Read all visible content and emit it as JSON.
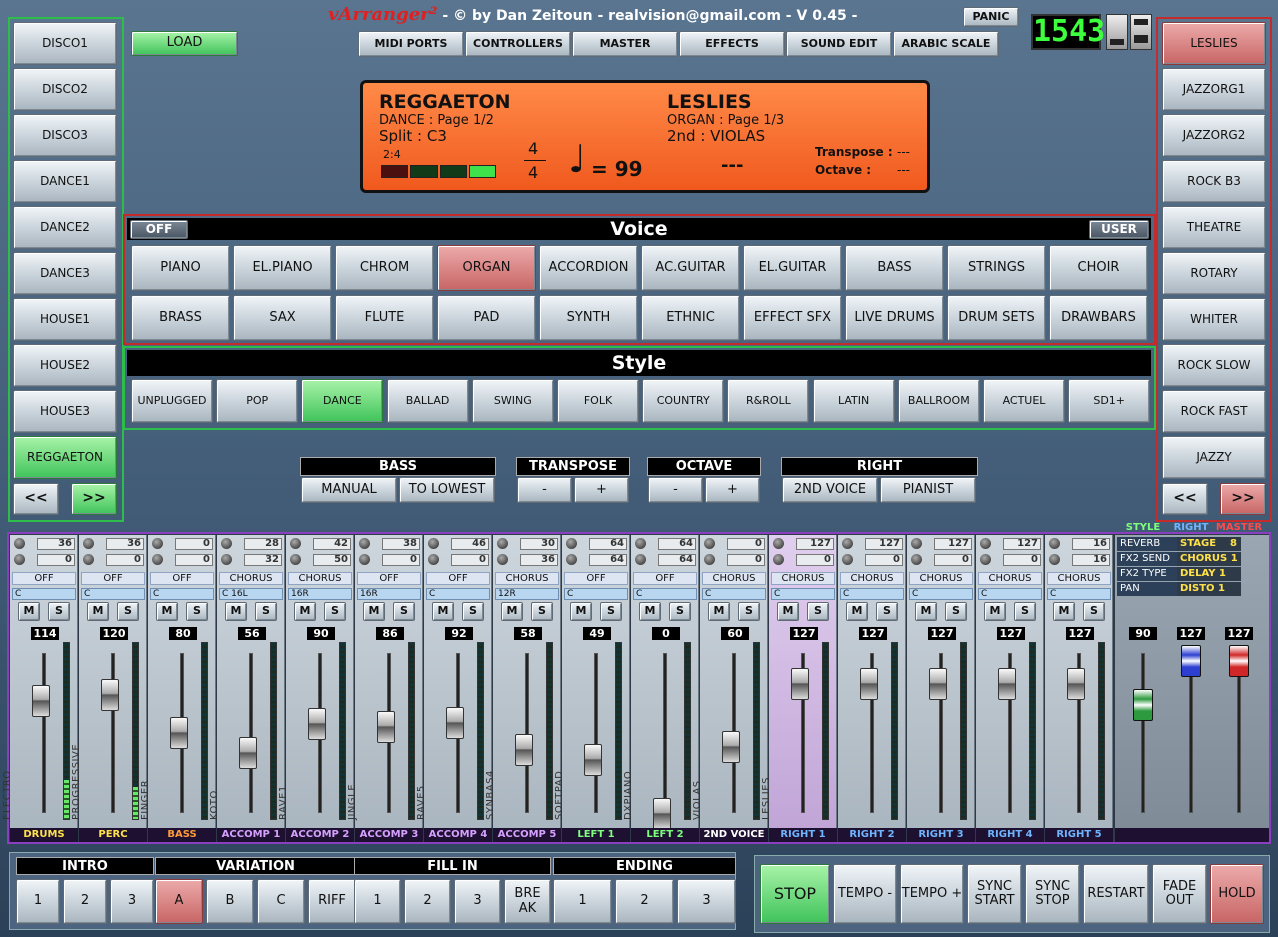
{
  "title": {
    "brand": "vArranger²",
    "subtitle": " - © by Dan Zeitoun - realvision@gmail.com - V 0.45 -"
  },
  "panic": "PANIC",
  "clock": "1543",
  "load": "LOAD",
  "topmenu": [
    "MIDI PORTS",
    "CONTROLLERS",
    "MASTER",
    "EFFECTS",
    "SOUND EDIT",
    "ARABIC SCALE"
  ],
  "left_styles": [
    "DISCO1",
    "DISCO2",
    "DISCO3",
    "DANCE1",
    "DANCE2",
    "DANCE3",
    "HOUSE1",
    "HOUSE2",
    "HOUSE3",
    "REGGAETON"
  ],
  "left_nav": [
    "<<",
    ">>"
  ],
  "right_voices": [
    "LESLIES",
    "JAZZORG1",
    "JAZZORG2",
    "ROCK B3",
    "THEATRE",
    "ROTARY",
    "WHITER",
    "ROCK SLOW",
    "ROCK FAST",
    "JAZZY"
  ],
  "right_nav": [
    "<<",
    ">>"
  ],
  "lcd": {
    "style_name": "REGGAETON",
    "style_page": "DANCE : Page 1/2",
    "split": "Split : C3",
    "beat": "2:4",
    "time_top": "4",
    "time_bottom": "4",
    "tempo": "= 99",
    "voice_name": "LESLIES",
    "voice_page": "ORGAN : Page 1/3",
    "second": "2nd : VIOLAS",
    "dashes": "---",
    "transpose_label": "Transpose :",
    "transpose_val": "---",
    "octave_label": "Octave :",
    "octave_val": "---"
  },
  "voice": {
    "title": "Voice",
    "off": "OFF",
    "user": "USER",
    "row1": [
      "PIANO",
      "EL.PIANO",
      "CHROM",
      "ORGAN",
      "ACCORDION",
      "AC.GUITAR",
      "EL.GUITAR",
      "BASS",
      "STRINGS",
      "CHOIR"
    ],
    "row2": [
      "BRASS",
      "SAX",
      "FLUTE",
      "PAD",
      "SYNTH",
      "ETHNIC",
      "EFFECT SFX",
      "LIVE DRUMS",
      "DRUM SETS",
      "DRAWBARS"
    ]
  },
  "style": {
    "title": "Style",
    "items": [
      "UNPLUGGED",
      "POP",
      "DANCE",
      "BALLAD",
      "SWING",
      "FOLK",
      "COUNTRY",
      "R&ROLL",
      "LATIN",
      "BALLROOM",
      "ACTUEL",
      "SD1+"
    ]
  },
  "controls": {
    "bass": {
      "label": "BASS",
      "b1": "MANUAL",
      "b2": "TO LOWEST"
    },
    "transpose": {
      "label": "TRANSPOSE",
      "b1": "-",
      "b2": "+"
    },
    "octave": {
      "label": "OCTAVE",
      "b1": "-",
      "b2": "+"
    },
    "right": {
      "label": "RIGHT",
      "b1": "2ND VOICE",
      "b2": "PIANIST"
    }
  },
  "mixer": [
    {
      "top1": "36",
      "top2": "0",
      "effect": "OFF",
      "pan": "C",
      "vol": "114",
      "name": "ELECTRO",
      "footer": "DRUMS",
      "foot_color": "#ffe24a",
      "fader": 0.78,
      "level": 0.22,
      "m": "M",
      "s": "S"
    },
    {
      "top1": "36",
      "top2": "0",
      "effect": "OFF",
      "pan": "C",
      "vol": "120",
      "name": "PROGRESSIVE",
      "footer": "PERC",
      "foot_color": "#ffe24a",
      "fader": 0.82,
      "level": 0.18,
      "m": "M",
      "s": "S"
    },
    {
      "top1": "0",
      "top2": "0",
      "effect": "OFF",
      "pan": "C",
      "vol": "80",
      "name": "FINGER",
      "footer": "BASS",
      "foot_color": "#ff9a3a",
      "fader": 0.56,
      "level": 0,
      "m": "M",
      "s": "S"
    },
    {
      "top1": "28",
      "top2": "32",
      "effect": "CHORUS",
      "pan": "C 16L",
      "vol": "56",
      "name": "KOTO",
      "footer": "ACCOMP 1",
      "foot_color": "#d6a0ff",
      "fader": 0.42,
      "level": 0,
      "m": "M",
      "s": "S"
    },
    {
      "top1": "42",
      "top2": "50",
      "effect": "CHORUS",
      "pan": "16R",
      "vol": "90",
      "name": "RAVE1",
      "footer": "ACCOMP 2",
      "foot_color": "#d6a0ff",
      "fader": 0.62,
      "level": 0,
      "m": "M",
      "s": "S"
    },
    {
      "top1": "38",
      "top2": "0",
      "effect": "OFF",
      "pan": "16R",
      "vol": "86",
      "name": "JINGLE",
      "footer": "ACCOMP 3",
      "foot_color": "#d6a0ff",
      "fader": 0.6,
      "level": 0,
      "m": "M",
      "s": "S"
    },
    {
      "top1": "46",
      "top2": "0",
      "effect": "OFF",
      "pan": "C",
      "vol": "92",
      "name": "RAVE5",
      "footer": "ACCOMP 4",
      "foot_color": "#d6a0ff",
      "fader": 0.63,
      "level": 0,
      "m": "M",
      "s": "S"
    },
    {
      "top1": "30",
      "top2": "36",
      "effect": "CHORUS",
      "pan": "12R",
      "vol": "58",
      "name": "SYNBAS4",
      "footer": "ACCOMP 5",
      "foot_color": "#d6a0ff",
      "fader": 0.44,
      "level": 0,
      "m": "M",
      "s": "S"
    },
    {
      "top1": "64",
      "top2": "64",
      "effect": "OFF",
      "pan": "C",
      "vol": "49",
      "name": "SOFTPAD",
      "footer": "LEFT 1",
      "foot_color": "#7dff7d",
      "fader": 0.37,
      "level": 0,
      "m": "M",
      "s": "S"
    },
    {
      "top1": "64",
      "top2": "64",
      "effect": "OFF",
      "pan": "C",
      "vol": "0",
      "name": "DXPIANO",
      "footer": "LEFT 2",
      "foot_color": "#7dff7d",
      "fader": 0.0,
      "level": 0,
      "m": "M",
      "s": "S"
    },
    {
      "top1": "0",
      "top2": "0",
      "effect": "CHORUS",
      "pan": "C",
      "vol": "60",
      "name": "VIOLAS",
      "footer": "2ND VOICE",
      "foot_color": "#ffffff",
      "fader": 0.46,
      "level": 0,
      "m": "M",
      "s": "S"
    },
    {
      "top1": "127",
      "top2": "0",
      "effect": "CHORUS",
      "pan": "C",
      "vol": "127",
      "name": "LESLIES",
      "footer": "RIGHT 1",
      "foot_color": "#6fb4ff",
      "fader": 0.9,
      "level": 0,
      "m": "M",
      "s": "S",
      "purple": true
    },
    {
      "top1": "127",
      "top2": "0",
      "effect": "CHORUS",
      "pan": "C",
      "vol": "127",
      "name": "",
      "footer": "RIGHT 2",
      "foot_color": "#6fb4ff",
      "fader": 0.9,
      "level": 0,
      "m": "M",
      "s": "S"
    },
    {
      "top1": "127",
      "top2": "0",
      "effect": "CHORUS",
      "pan": "C",
      "vol": "127",
      "name": "",
      "footer": "RIGHT 3",
      "foot_color": "#6fb4ff",
      "fader": 0.9,
      "level": 0,
      "m": "M",
      "s": "S"
    },
    {
      "top1": "127",
      "top2": "0",
      "effect": "CHORUS",
      "pan": "C",
      "vol": "127",
      "name": "",
      "footer": "RIGHT 4",
      "foot_color": "#6fb4ff",
      "fader": 0.9,
      "level": 0,
      "m": "M",
      "s": "S"
    },
    {
      "top1": "16",
      "top2": "16",
      "effect": "CHORUS",
      "pan": "C",
      "vol": "127",
      "name": "",
      "footer": "RIGHT 5",
      "foot_color": "#6fb4ff",
      "fader": 0.9,
      "level": 0,
      "m": "M",
      "s": "S"
    }
  ],
  "fx": [
    {
      "label": "REVERB",
      "value": "STAGE",
      "num": "8"
    },
    {
      "label": "FX2 SEND",
      "value": "CHORUS 1",
      "num": ""
    },
    {
      "label": "FX2 TYPE",
      "value": "DELAY 1",
      "num": ""
    },
    {
      "label": "PAN",
      "value": "DISTO 1",
      "num": ""
    }
  ],
  "master": [
    {
      "vol": "90",
      "label": "STYLE",
      "color": "#7dff7d",
      "thumb": "#2d9a3f",
      "fader": 0.7
    },
    {
      "vol": "127",
      "label": "RIGHT",
      "color": "#6fb4ff",
      "thumb": "#2c3fd0",
      "fader": 1.0
    },
    {
      "vol": "127",
      "label": "MASTER",
      "color": "#ff4a4a",
      "thumb": "#d02828",
      "fader": 1.0
    }
  ],
  "sections": {
    "intro": {
      "label": "INTRO",
      "items": [
        "1",
        "2",
        "3"
      ]
    },
    "variation": {
      "label": "VARIATION",
      "items": [
        "A",
        "B",
        "C",
        "RIFF"
      ]
    },
    "fillin": {
      "label": "FILL IN",
      "items": [
        "1",
        "2",
        "3",
        "BRE AK"
      ]
    },
    "ending": {
      "label": "ENDING",
      "items": [
        "1",
        "2",
        "3"
      ]
    }
  },
  "transport": [
    "STOP",
    "TEMPO -",
    "TEMPO +",
    "SYNC START",
    "SYNC STOP",
    "RESTART",
    "FADE OUT",
    "HOLD"
  ]
}
